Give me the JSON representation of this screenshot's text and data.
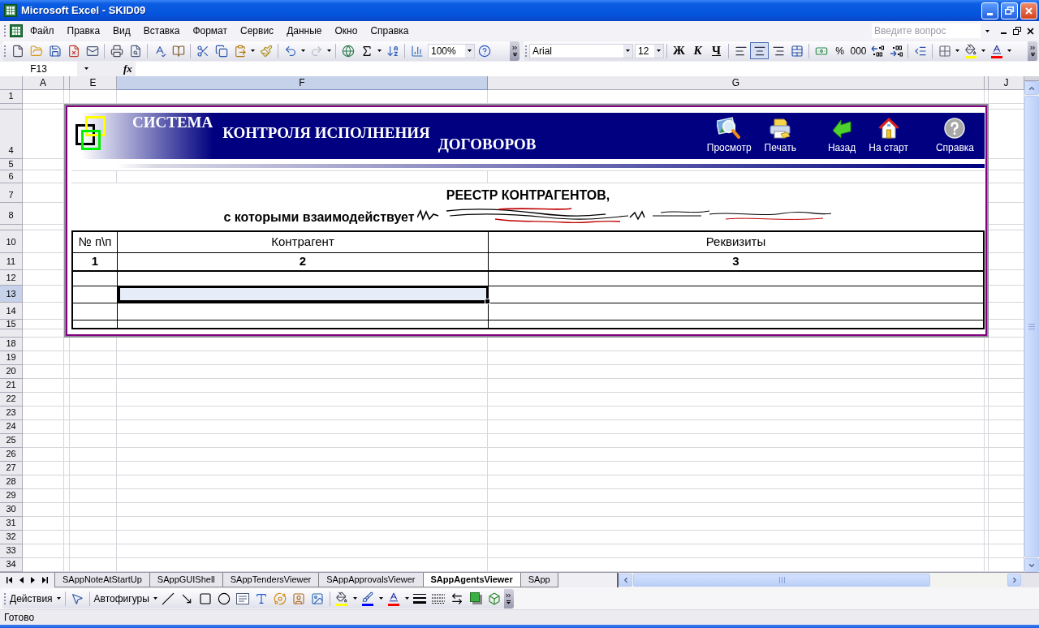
{
  "window": {
    "title": "Microsoft Excel - SKID09"
  },
  "menu_bar": {
    "items": [
      "Файл",
      "Правка",
      "Вид",
      "Вставка",
      "Формат",
      "Сервис",
      "Данные",
      "Окно",
      "Справка"
    ],
    "help_search": {
      "placeholder": "Введите вопрос"
    }
  },
  "standard_toolbar": {
    "zoom": "100%",
    "redo": {
      "disabled": true
    }
  },
  "formatting_toolbar": {
    "font": "Arial",
    "size": "12",
    "style_buttons": [
      {
        "label": "Ж",
        "selected": false
      },
      {
        "label": "К",
        "selected": false
      },
      {
        "label": "Ч",
        "selected": false
      }
    ],
    "alignment": [
      {
        "selected": false
      },
      {
        "selected": true
      },
      {
        "selected": false
      }
    ],
    "number_buttons": [
      "%",
      "000"
    ]
  },
  "formula_bar": {
    "name_box": "F13",
    "function_button": "fx"
  },
  "columns": [
    {
      "label": "A",
      "selected": false
    },
    {
      "selected": false
    },
    {
      "label": "E",
      "selected": false
    },
    {
      "label": "F",
      "selected": true
    },
    {
      "label": "G",
      "selected": false
    },
    {
      "selected": false
    },
    {
      "label": "J",
      "selected": false
    }
  ],
  "rows": [
    {
      "label": "1",
      "selected": false
    },
    {
      "selected": false
    },
    {
      "label": "4",
      "selected": false
    },
    {
      "label": "5",
      "selected": false
    },
    {
      "label": "6",
      "selected": false
    },
    {
      "label": "7",
      "selected": false
    },
    {
      "label": "8",
      "selected": false
    },
    {
      "selected": false
    },
    {
      "label": "10",
      "selected": false
    },
    {
      "label": "11",
      "selected": false
    },
    {
      "label": "12",
      "selected": false
    },
    {
      "label": "13",
      "selected": true
    },
    {
      "label": "14",
      "selected": false
    },
    {
      "label": "15",
      "selected": false
    },
    {
      "selected": false
    },
    {
      "label": "18",
      "selected": false
    },
    {
      "label": "19",
      "selected": false
    },
    {
      "label": "20",
      "selected": false
    },
    {
      "label": "21",
      "selected": false
    },
    {
      "label": "22",
      "selected": false
    },
    {
      "label": "23",
      "selected": false
    },
    {
      "label": "24",
      "selected": false
    },
    {
      "label": "25",
      "selected": false
    },
    {
      "label": "26",
      "selected": false
    },
    {
      "label": "27",
      "selected": false
    },
    {
      "label": "28",
      "selected": false
    },
    {
      "label": "29",
      "selected": false
    },
    {
      "label": "30",
      "selected": false
    },
    {
      "label": "31",
      "selected": false
    },
    {
      "label": "32",
      "selected": false
    },
    {
      "label": "33",
      "selected": false
    },
    {
      "label": "34",
      "selected": false
    }
  ],
  "report": {
    "banner": {
      "title": [
        "СИСТЕМА",
        "КОНТРОЛЯ ИСПОЛНЕНИЯ",
        "ДОГОВОРОВ"
      ],
      "buttons": [
        "Просмотр",
        "Печать",
        "Назад",
        "На старт",
        "Справка"
      ]
    },
    "title": "РЕЕСТР КОНТРАГЕНТОВ,",
    "subtitle": "с которыми взаимодействует",
    "table": {
      "columns": [
        "№ п\\п",
        "Контрагент",
        "Реквизиты"
      ],
      "numbering": [
        "1",
        "2",
        "3"
      ],
      "rows": [
        {
          "cells": [
            {
              "selected": false
            },
            {
              "selected": false
            },
            {
              "selected": false
            }
          ]
        },
        {
          "cells": [
            {
              "selected": false
            },
            {
              "selected": true
            },
            {
              "selected": false
            }
          ]
        },
        {
          "cells": [
            {
              "selected": false
            },
            {
              "selected": false
            },
            {
              "selected": false
            }
          ]
        },
        {
          "cells": [
            {
              "selected": false
            },
            {
              "selected": false
            },
            {
              "selected": false
            }
          ]
        }
      ]
    }
  },
  "sheet_tabs": [
    {
      "label": "SAppNoteAtStartUp",
      "selected": false
    },
    {
      "label": "SAppGUIShell",
      "selected": false
    },
    {
      "label": "SAppTendersViewer",
      "selected": false
    },
    {
      "label": "SAppApprovalsViewer",
      "selected": false
    },
    {
      "label": "SAppAgentsViewer",
      "selected": true
    },
    {
      "label": "SApp",
      "selected": false
    }
  ],
  "drawing_toolbar": {
    "actions": "Действия",
    "autoshapes": "Автофигуры"
  },
  "status_bar": {
    "text": "Готово"
  }
}
